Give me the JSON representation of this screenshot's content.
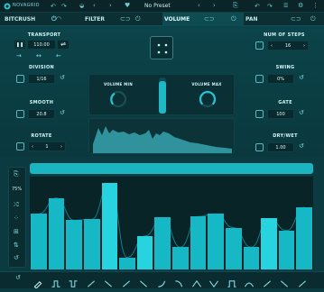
{
  "app": {
    "brand": "NOVAGRID",
    "preset": "No Preset"
  },
  "tabs": [
    {
      "label": "BITCRUSH"
    },
    {
      "label": "FILTER"
    },
    {
      "label": "VOLUME"
    },
    {
      "label": "PAN"
    }
  ],
  "transport": {
    "label": "TRANSPORT",
    "tempo": "110.00"
  },
  "division": {
    "label": "DIVISION",
    "value": "1/16"
  },
  "smooth": {
    "label": "SMOOTH",
    "value": "20.8"
  },
  "rotate": {
    "label": "ROTATE",
    "value": "1"
  },
  "steps": {
    "label": "NUM OF STEPS",
    "value": "16"
  },
  "swing": {
    "label": "SWING",
    "value": "0%"
  },
  "gate": {
    "label": "GATE",
    "value": "100"
  },
  "drywet": {
    "label": "DRY/WET",
    "value": "1.00"
  },
  "volume": {
    "min_label": "VOLUME MIN",
    "max_label": "VOLUME MAX",
    "max_level": 0.85,
    "min_level": 0.2,
    "slider_level": 0.9
  },
  "sequencer": {
    "zoom": "75%",
    "levels": [
      0.6,
      0.77,
      0.53,
      0.54,
      0.93,
      0.13,
      0.36,
      0.56,
      0.24,
      0.57,
      0.6,
      0.45,
      0.24,
      0.55,
      0.42,
      0.67
    ],
    "highlight": [
      4,
      6,
      13
    ]
  },
  "colors": {
    "accent": "#16b8c6",
    "highlight": "#26d3df",
    "background": "#0b3a40"
  },
  "footer": {
    "shapes": [
      "pencil-icon",
      "square-wave-icon",
      "square-wave-alt-icon",
      "ramp-up-icon",
      "ramp-down-icon",
      "ramp-up-icon",
      "ramp-down-icon",
      "curve-up-icon",
      "curve-down-icon",
      "triangle-icon",
      "triangle-alt-icon",
      "pulse-icon",
      "pulse-alt-icon",
      "ramp-up-icon",
      "ramp-down-icon",
      "ramp-up-icon"
    ]
  }
}
